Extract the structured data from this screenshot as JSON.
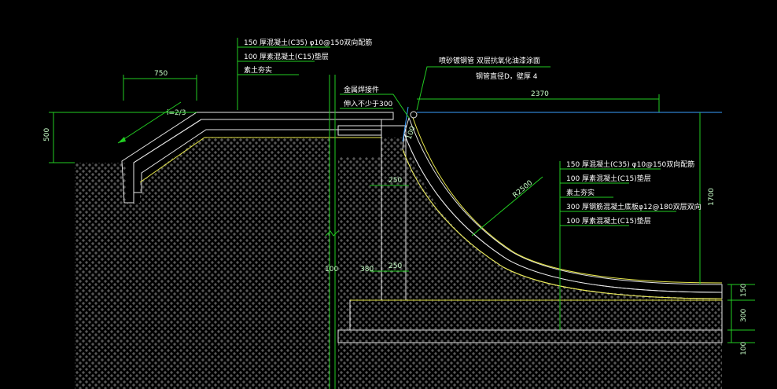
{
  "top_callout": {
    "lines": [
      "150  厚混凝土(C35) φ10@150双向配筋",
      "100  厚素混凝土(C15)垫层",
      "素土夯实"
    ]
  },
  "right_callout": {
    "lines": [
      "150  厚混凝土(C35) φ10@150双向配筋",
      "100  厚素混凝土(C15)垫层",
      "素土夯实",
      "300  厚钢筋混凝土底板φ12@180双层双向",
      "100  厚素混凝土(C15)垫层"
    ]
  },
  "pipe_note": {
    "line1": "喷砂镀钢管 双层抗氧化油漆涂面",
    "line2": "钢管直径D，壁厚 4"
  },
  "metal_note": {
    "line1": "金属焊接件",
    "line2": "伸入不少于300"
  },
  "dims": {
    "d750": "750",
    "slope": "i=2/3",
    "d500": "500",
    "d2370": "2370",
    "d250_top": "250",
    "d250_bottom": "250",
    "d100": "100",
    "d380": "380",
    "radius": "R2500",
    "d1700": "1700",
    "d150": "150",
    "d300": "300",
    "d100_right": "100",
    "offset": "100"
  }
}
